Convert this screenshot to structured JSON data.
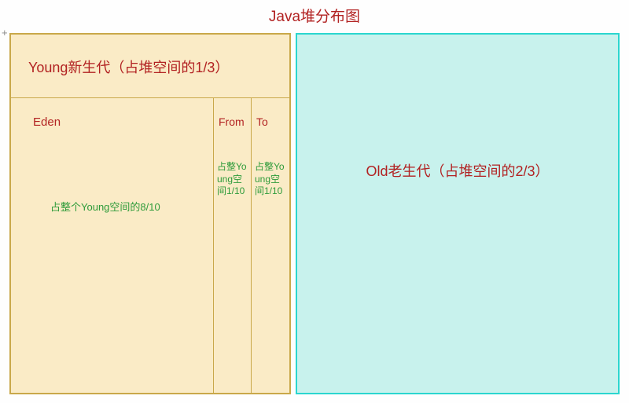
{
  "title": "Java堆分布图",
  "plus_marker": "+",
  "young": {
    "header": "Young新生代（占堆空间的1/3）",
    "eden": {
      "label": "Eden",
      "desc": "占整个Young空间的8/10"
    },
    "from": {
      "label": "From",
      "desc": "占整Young空间1/10"
    },
    "to": {
      "label": "To",
      "desc": "占整Young空间1/10"
    }
  },
  "old": {
    "label": "Old老生代（占堆空间的2/3）"
  }
}
